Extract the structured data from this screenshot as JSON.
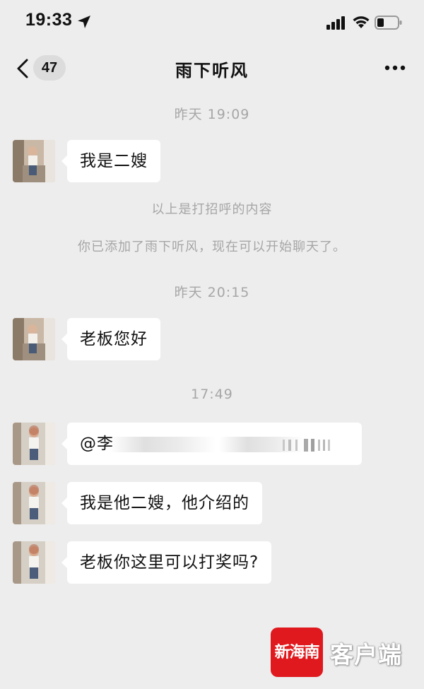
{
  "status_bar": {
    "time": "19:33",
    "icons": [
      "location-arrow-icon",
      "signal-icon",
      "wifi-icon",
      "battery-icon"
    ]
  },
  "nav": {
    "unread_count": "47",
    "title": "雨下听风",
    "icons": [
      "back-chevron-icon",
      "more-dots-icon"
    ]
  },
  "messages": {
    "ts1": "昨天 19:09",
    "msg1": "我是二嫂",
    "note1": "以上是打招呼的内容",
    "note2": "你已添加了雨下听风，现在可以开始聊天了。",
    "ts2": "昨天 20:15",
    "msg2": "老板您好",
    "ts3": "17:49",
    "msg3": "@李",
    "msg4": "我是他二嫂，他介绍的",
    "msg5": "老板你这里可以打奖吗?"
  },
  "watermark": {
    "logo_text": "新海南",
    "text": "客户端"
  },
  "colors": {
    "background": "#ededed",
    "bubble": "#ffffff",
    "muted_text": "#a6a6a6",
    "watermark_red": "#e0191e"
  }
}
